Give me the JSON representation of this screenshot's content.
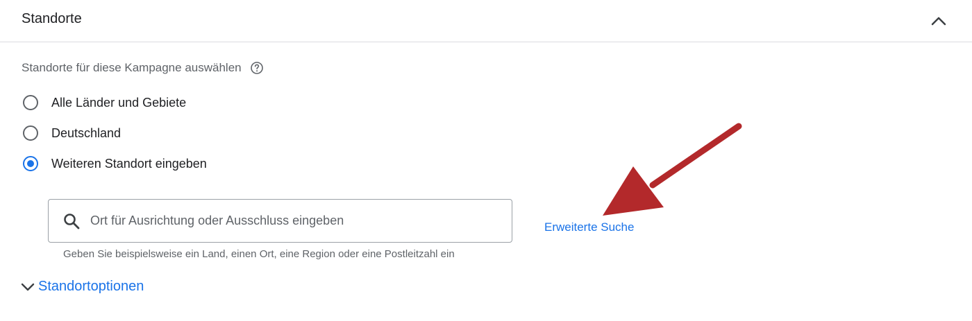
{
  "panel": {
    "title": "Standorte"
  },
  "section": {
    "label": "Standorte für diese Kampagne auswählen"
  },
  "radios": [
    {
      "label": "Alle Länder und Gebiete",
      "checked": false
    },
    {
      "label": "Deutschland",
      "checked": false
    },
    {
      "label": "Weiteren Standort eingeben",
      "checked": true
    }
  ],
  "search": {
    "placeholder": "Ort für Ausrichtung oder Ausschluss eingeben",
    "value": "",
    "hint": "Geben Sie beispielsweise ein Land, einen Ort, eine Region oder eine Postleitzahl ein"
  },
  "advanced_search": {
    "label": "Erweiterte Suche"
  },
  "location_options": {
    "label": "Standortoptionen"
  },
  "icons": {
    "collapse": "chevron-up-icon",
    "help": "help-circle-icon",
    "search": "search-icon",
    "expand": "chevron-down-icon",
    "annotation": "red-arrow-annotation"
  },
  "colors": {
    "accent": "#1a73e8",
    "annotation_arrow": "#b3292b",
    "divider": "#dadce0"
  }
}
